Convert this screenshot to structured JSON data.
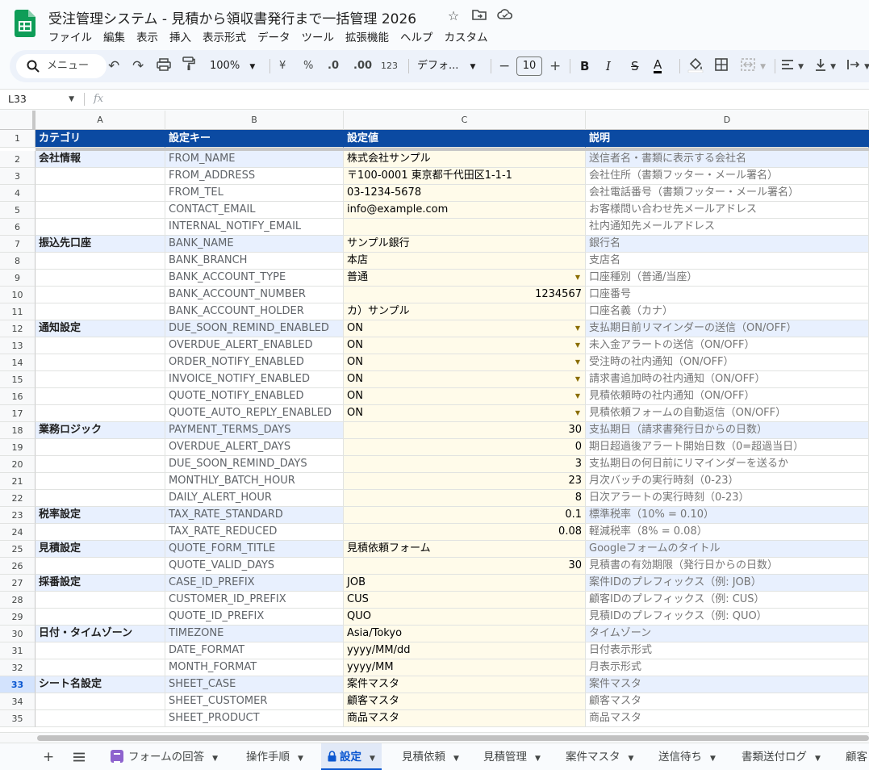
{
  "window": {
    "title": "受注管理システム - 見積から領収書発行まで一括管理 2026",
    "menu": [
      "ファイル",
      "編集",
      "表示",
      "挿入",
      "表示形式",
      "データ",
      "ツール",
      "拡張機能",
      "ヘルプ",
      "カスタム"
    ]
  },
  "toolbar": {
    "search_label": "メニュー",
    "zoom": "100%",
    "currency": "¥",
    "percent": "%",
    "dec_decrease": ".0",
    "dec_increase": ".00",
    "number_format": "123",
    "font_name": "デフォ...",
    "font_size": "10",
    "bold": "B",
    "italic": "I",
    "strike": "S",
    "text_color": "A"
  },
  "formula_bar": {
    "cell_ref": "L33",
    "fx": "fx",
    "content": ""
  },
  "columns": [
    "A",
    "B",
    "C",
    "D"
  ],
  "colors": {
    "header_bg": "#0b4aa2",
    "section_bg": "#e8f0fe",
    "value_bg": "#fffbea",
    "selected_row": "#d3e3fd"
  },
  "rows": [
    {
      "n": "1",
      "a": "カテゴリ",
      "b": "設定キー",
      "c": "設定値",
      "d": "説明",
      "type": "header"
    },
    {
      "n": "2",
      "a": "会社情報",
      "b": "FROM_NAME",
      "c": "株式会社サンプル",
      "d": "送信者名・書類に表示する会社名",
      "type": "section"
    },
    {
      "n": "3",
      "a": "",
      "b": "FROM_ADDRESS",
      "c": "〒100-0001 東京都千代田区1-1-1",
      "d": "会社住所（書類フッター・メール署名）"
    },
    {
      "n": "4",
      "a": "",
      "b": "FROM_TEL",
      "c": "03-1234-5678",
      "d": "会社電話番号（書類フッター・メール署名）"
    },
    {
      "n": "5",
      "a": "",
      "b": "CONTACT_EMAIL",
      "c": "info@example.com",
      "d": "お客様問い合わせ先メールアドレス"
    },
    {
      "n": "6",
      "a": "",
      "b": "INTERNAL_NOTIFY_EMAIL",
      "c": "",
      "d": "社内通知先メールアドレス"
    },
    {
      "n": "7",
      "a": "振込先口座",
      "b": "BANK_NAME",
      "c": "サンプル銀行",
      "d": "銀行名",
      "type": "section"
    },
    {
      "n": "8",
      "a": "",
      "b": "BANK_BRANCH",
      "c": "本店",
      "d": "支店名"
    },
    {
      "n": "9",
      "a": "",
      "b": "BANK_ACCOUNT_TYPE",
      "c": "普通",
      "d": "口座種別（普通/当座）",
      "dd": true
    },
    {
      "n": "10",
      "a": "",
      "b": "BANK_ACCOUNT_NUMBER",
      "c": "1234567",
      "d": "口座番号",
      "num": true
    },
    {
      "n": "11",
      "a": "",
      "b": "BANK_ACCOUNT_HOLDER",
      "c": "カ）サンプル",
      "d": "口座名義（カナ）"
    },
    {
      "n": "12",
      "a": "通知設定",
      "b": "DUE_SOON_REMIND_ENABLED",
      "c": "ON",
      "d": "支払期日前リマインダーの送信（ON/OFF）",
      "type": "section",
      "dd": true
    },
    {
      "n": "13",
      "a": "",
      "b": "OVERDUE_ALERT_ENABLED",
      "c": "ON",
      "d": "未入金アラートの送信（ON/OFF）",
      "dd": true
    },
    {
      "n": "14",
      "a": "",
      "b": "ORDER_NOTIFY_ENABLED",
      "c": "ON",
      "d": "受注時の社内通知（ON/OFF）",
      "dd": true
    },
    {
      "n": "15",
      "a": "",
      "b": "INVOICE_NOTIFY_ENABLED",
      "c": "ON",
      "d": "請求書追加時の社内通知（ON/OFF）",
      "dd": true
    },
    {
      "n": "16",
      "a": "",
      "b": "QUOTE_NOTIFY_ENABLED",
      "c": "ON",
      "d": "見積依頼時の社内通知（ON/OFF）",
      "dd": true
    },
    {
      "n": "17",
      "a": "",
      "b": "QUOTE_AUTO_REPLY_ENABLED",
      "c": "ON",
      "d": "見積依頼フォームの自動返信（ON/OFF）",
      "dd": true
    },
    {
      "n": "18",
      "a": "業務ロジック",
      "b": "PAYMENT_TERMS_DAYS",
      "c": "30",
      "d": "支払期日（請求書発行日からの日数）",
      "type": "section",
      "num": true
    },
    {
      "n": "19",
      "a": "",
      "b": "OVERDUE_ALERT_DAYS",
      "c": "0",
      "d": "期日超過後アラート開始日数（0=超過当日）",
      "num": true
    },
    {
      "n": "20",
      "a": "",
      "b": "DUE_SOON_REMIND_DAYS",
      "c": "3",
      "d": "支払期日の何日前にリマインダーを送るか",
      "num": true
    },
    {
      "n": "21",
      "a": "",
      "b": "MONTHLY_BATCH_HOUR",
      "c": "23",
      "d": "月次バッチの実行時刻（0-23）",
      "num": true
    },
    {
      "n": "22",
      "a": "",
      "b": "DAILY_ALERT_HOUR",
      "c": "8",
      "d": "日次アラートの実行時刻（0-23）",
      "num": true
    },
    {
      "n": "23",
      "a": "税率設定",
      "b": "TAX_RATE_STANDARD",
      "c": "0.1",
      "d": "標準税率（10% = 0.10）",
      "type": "section",
      "num": true
    },
    {
      "n": "24",
      "a": "",
      "b": "TAX_RATE_REDUCED",
      "c": "0.08",
      "d": "軽減税率（8% = 0.08）",
      "num": true
    },
    {
      "n": "25",
      "a": "見積設定",
      "b": "QUOTE_FORM_TITLE",
      "c": "見積依頼フォーム",
      "d": "Googleフォームのタイトル",
      "type": "section"
    },
    {
      "n": "26",
      "a": "",
      "b": "QUOTE_VALID_DAYS",
      "c": "30",
      "d": "見積書の有効期限（発行日からの日数）",
      "num": true
    },
    {
      "n": "27",
      "a": "採番設定",
      "b": "CASE_ID_PREFIX",
      "c": "JOB",
      "d": "案件IDのプレフィックス（例: JOB）",
      "type": "section"
    },
    {
      "n": "28",
      "a": "",
      "b": "CUSTOMER_ID_PREFIX",
      "c": "CUS",
      "d": "顧客IDのプレフィックス（例: CUS）"
    },
    {
      "n": "29",
      "a": "",
      "b": "QUOTE_ID_PREFIX",
      "c": "QUO",
      "d": "見積IDのプレフィックス（例: QUO）"
    },
    {
      "n": "30",
      "a": "日付・タイムゾーン",
      "b": "TIMEZONE",
      "c": "Asia/Tokyo",
      "d": "タイムゾーン",
      "type": "section"
    },
    {
      "n": "31",
      "a": "",
      "b": "DATE_FORMAT",
      "c": "yyyy/MM/dd",
      "d": "日付表示形式"
    },
    {
      "n": "32",
      "a": "",
      "b": "MONTH_FORMAT",
      "c": "yyyy/MM",
      "d": "月表示形式"
    },
    {
      "n": "33",
      "a": "シート名設定",
      "b": "SHEET_CASE",
      "c": "案件マスタ",
      "d": "案件マスタ",
      "type": "section",
      "selected": true
    },
    {
      "n": "34",
      "a": "",
      "b": "SHEET_CUSTOMER",
      "c": "顧客マスタ",
      "d": "顧客マスタ"
    },
    {
      "n": "35",
      "a": "",
      "b": "SHEET_PRODUCT",
      "c": "商品マスタ",
      "d": "商品マスタ"
    }
  ],
  "sheet_tabs": [
    {
      "label": "フォームの回答",
      "icon": "form-icon"
    },
    {
      "label": "操作手順"
    },
    {
      "label": "設定",
      "icon": "lock-icon",
      "active": true
    },
    {
      "label": "見積依頼"
    },
    {
      "label": "見積管理"
    },
    {
      "label": "案件マスタ"
    },
    {
      "label": "送信待ち"
    },
    {
      "label": "書類送付ログ"
    },
    {
      "label": "顧客"
    }
  ]
}
